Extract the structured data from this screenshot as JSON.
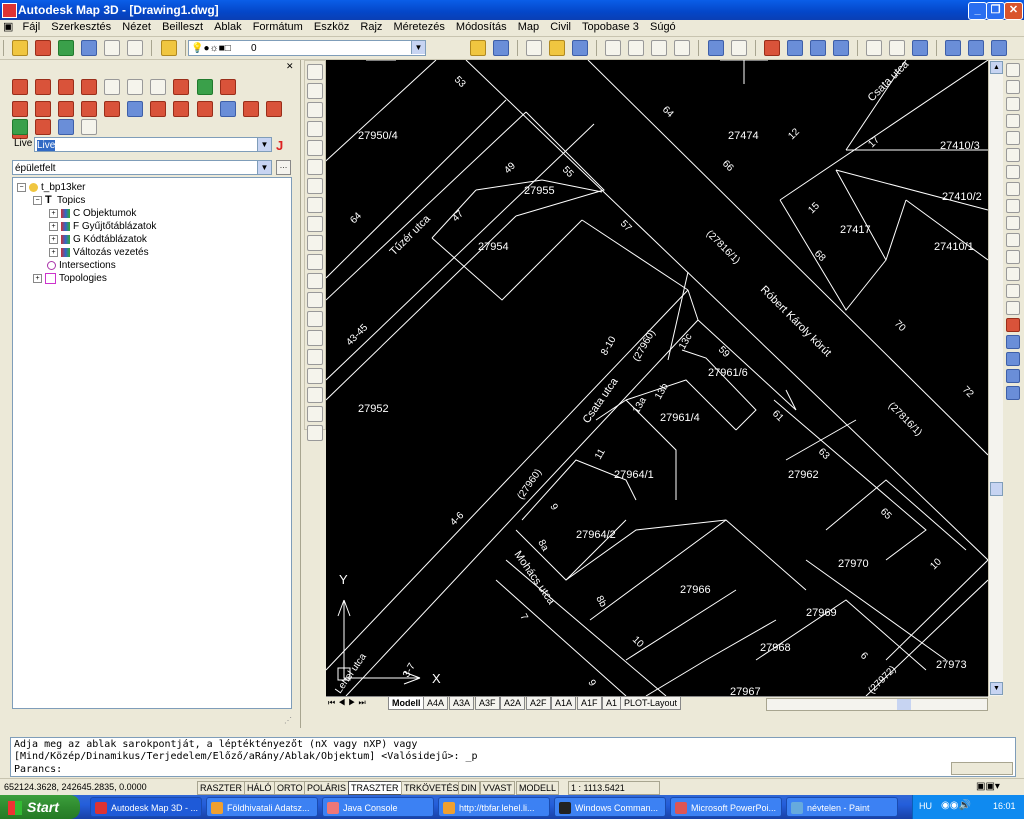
{
  "window": {
    "title": "Autodesk Map 3D - [Drawing1.dwg]"
  },
  "menu": [
    "Fájl",
    "Szerkesztés",
    "Nézet",
    "Beilleszt",
    "Ablak",
    "Formátum",
    "Eszköz",
    "Rajz",
    "Méretezés",
    "Módosítás",
    "Map",
    "Civil",
    "Topobase 3",
    "Súgó"
  ],
  "layer_combo": {
    "value": "0"
  },
  "left_panel": {
    "live_label": "Live",
    "live_value": "Live",
    "query_value": "épületfelt",
    "tree": [
      {
        "label": "t_bp13ker",
        "level": 0
      },
      {
        "label": "Topics",
        "level": 1
      },
      {
        "label": "C Objektumok",
        "level": 2
      },
      {
        "label": "F Gyűjtőtáblázatok",
        "level": 2
      },
      {
        "label": "G Kódtáblázatok",
        "level": 2
      },
      {
        "label": "Változás vezetés",
        "level": 2
      },
      {
        "label": "Intersections",
        "level": 1
      },
      {
        "label": "Topologies",
        "level": 1
      }
    ]
  },
  "map_labels": {
    "parcels": [
      "27950/4",
      "27474",
      "27410/3",
      "27955",
      "27954",
      "27417",
      "27410/2",
      "27410/1",
      "27952",
      "27961/6",
      "27961/4",
      "27962",
      "27964/1",
      "27964/2",
      "27970",
      "27966",
      "27969",
      "27968",
      "27973",
      "27967"
    ],
    "house_numbers": [
      "53",
      "64",
      "12",
      "17",
      "49",
      "55",
      "66",
      "47",
      "57",
      "15",
      "64",
      "68",
      "70",
      "43-45",
      "8-10",
      "13c",
      "59",
      "13a",
      "13b",
      "72",
      "61",
      "11",
      "63",
      "9",
      "65",
      "4-6",
      "8a",
      "8b",
      "6",
      "10",
      "10",
      "7",
      "9",
      "3-7"
    ],
    "streets": [
      "Csata utca",
      "Tűzér utca",
      "Róbert Károly körút",
      "Csata utca",
      "Mohács utca",
      "Lehel utca"
    ],
    "references": [
      "(27816/1)",
      "(27960)",
      "(27816/1)",
      "(27960)",
      "(27972)"
    ],
    "ucs": {
      "y": "Y",
      "x": "X"
    }
  },
  "layout_tabs": [
    "Modell",
    "A4A",
    "A3A",
    "A3F",
    "A2A",
    "A2F",
    "A1A",
    "A1F",
    "A1",
    "PLOT-Layout"
  ],
  "command": {
    "line1": "Adja meg az ablak sarokpontját, a léptéktényezőt (nX vagy nXP) vagy",
    "line2": "[Mind/Közép/Dinamikus/Terjedelem/Előző/aRány/Ablak/Objektum] <Valósidejű>: _p",
    "prompt": "Parancs:"
  },
  "status": {
    "coords": "652124.3628, 242645.2835, 0.0000",
    "toggles": [
      "RASZTER",
      "HÁLÓ",
      "ORTO",
      "POLÁRIS",
      "TRASZTER",
      "TRKÖVETÉS",
      "DIN",
      "VVAST",
      "MODELL"
    ],
    "scale": "1 : 1113.5421"
  },
  "taskbar": {
    "start": "Start",
    "tasks": [
      "Autodesk Map 3D - ...",
      "Földhivatali Adatsz...",
      "Java Console",
      "http://tbfar.lehel.li...",
      "Windows Comman...",
      "Microsoft PowerPoi...",
      "névtelen - Paint"
    ],
    "lang": "HU",
    "clock": "16:01"
  },
  "colors": {
    "canvas": "#000000",
    "lines": "#ffffff",
    "titlebar": "#0a5ee8"
  }
}
